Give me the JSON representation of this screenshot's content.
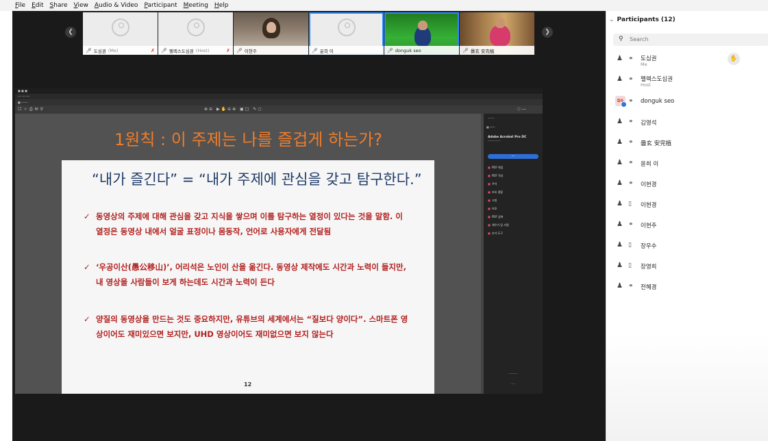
{
  "menu": [
    "File",
    "Edit",
    "Share",
    "View",
    "Audio & Video",
    "Participant",
    "Meeting",
    "Help"
  ],
  "thumbnails": [
    {
      "name": "도심권",
      "tag": "(Me)",
      "muted": true
    },
    {
      "name": "펠렉스도심권",
      "tag": "(Host)",
      "muted": true
    },
    {
      "name": "이현주",
      "tag": "",
      "muted": false
    },
    {
      "name": "윤희 이",
      "tag": "",
      "muted": false
    },
    {
      "name": "donguk seo",
      "tag": "",
      "muted": false
    },
    {
      "name": "曇玄 安完植",
      "tag": "",
      "muted": false
    }
  ],
  "share": {
    "slide_heading": "1원칙 : 이 주제는 나를 즐겁게 하는가?",
    "quote": "“내가 즐긴다” = “내가 주제에 관심을 갖고 탐구한다.”",
    "bullets": [
      "동영상의 주제에 대해 관심을 갖고 지식을 쌓으며 이를 탐구하는 열정이 있다는 것을 말함. 이 열정은 동영상 내에서 얼굴 표정이나 몸동작, 언어로 사용자에게 전달됨",
      "‘우공이산(愚公移山)’, 어리석은 노인이 산을 옮긴다. 동영상 제작에도 시간과 노력이 들지만, 내 영상을 사람들이 보게 하는데도 시간과 노력이 든다",
      "양질의 동영상을 만드는 것도 중요하지만, 유튜브의 세계에서는 “질보다 양이다”. 스마트폰 영상이어도 재미있으면 보지만, UHD 영상이어도 재미없으면 보지 않는다"
    ],
    "page_number": "12",
    "acrobat": {
      "product": "Adobe Acrobat Pro DC",
      "tools": [
        "PDF 편집",
        "PDF 작성",
        "주석",
        "보호 결합",
        "고침",
        "보호",
        "PDF 압축",
        "채우기 및 서명",
        "추가 도구"
      ]
    }
  },
  "participants": {
    "title": "Participants (12)",
    "search_placeholder": "Search",
    "list": [
      {
        "name": "도심권",
        "sub": "Me",
        "icon": "user",
        "device": "mic",
        "raised": true
      },
      {
        "name": "펠렉스도심권",
        "sub": "Host",
        "icon": "user",
        "device": "mic",
        "raised": false
      },
      {
        "name": "donguk seo",
        "sub": "",
        "icon": "DS",
        "device": "mic",
        "raised": false
      },
      {
        "name": "김영석",
        "sub": "",
        "icon": "user",
        "device": "mic",
        "raised": false
      },
      {
        "name": "曇玄 安完植",
        "sub": "",
        "icon": "user",
        "device": "mic",
        "raised": false
      },
      {
        "name": "윤희 이",
        "sub": "",
        "icon": "user",
        "device": "mic",
        "raised": false
      },
      {
        "name": "이현경",
        "sub": "",
        "icon": "user",
        "device": "mic",
        "raised": false
      },
      {
        "name": "이현경",
        "sub": "",
        "icon": "user",
        "device": "phone",
        "raised": false
      },
      {
        "name": "이현주",
        "sub": "",
        "icon": "user",
        "device": "mic",
        "raised": false
      },
      {
        "name": "장우수",
        "sub": "",
        "icon": "user",
        "device": "phone",
        "raised": false
      },
      {
        "name": "장영희",
        "sub": "",
        "icon": "user",
        "device": "phone",
        "raised": false
      },
      {
        "name": "전혜경",
        "sub": "",
        "icon": "user",
        "device": "mic",
        "raised": false
      }
    ]
  }
}
